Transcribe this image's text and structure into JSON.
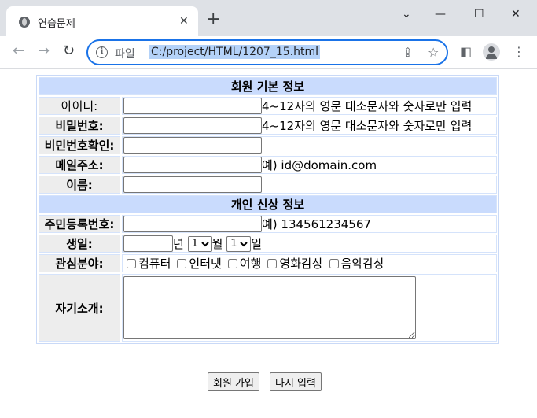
{
  "browser": {
    "tab_title": "연습문제",
    "tab_close": "✕",
    "new_tab": "+",
    "url_scheme_label": "파일",
    "url": "C:/project/HTML/1207_15.html",
    "window_controls": {
      "minimize": "—",
      "maximize": "☐",
      "close": "✕",
      "dropdown": "⌄"
    }
  },
  "form": {
    "section_basic": "회원 기본 정보",
    "section_personal": "개인 신상 정보",
    "rows": {
      "id_label": "아이디:",
      "id_hint": "4~12자의 영문 대소문자와 숫자로만 입력",
      "pw_label": "비밀번호:",
      "pw_hint": "4~12자의 영문 대소문자와 숫자로만 입력",
      "pw_confirm_label": "비민번호확인:",
      "email_label": "메일주소:",
      "email_hint": "예) id@domain.com",
      "name_label": "이름:",
      "rrn_label": "주민등록번호:",
      "rrn_hint": "예) 134561234567",
      "birth_label": "생일:",
      "year_unit": "년",
      "month_value": "1",
      "month_unit": "월",
      "day_value": "1",
      "day_unit": "일",
      "interest_label": "관심분야:",
      "interests": [
        "컴퓨터",
        "인터넷",
        "여행",
        "영화감상",
        "음악감상"
      ],
      "intro_label": "자기소개:"
    },
    "submit_label": "회원 가입",
    "reset_label": "다시 입력"
  }
}
